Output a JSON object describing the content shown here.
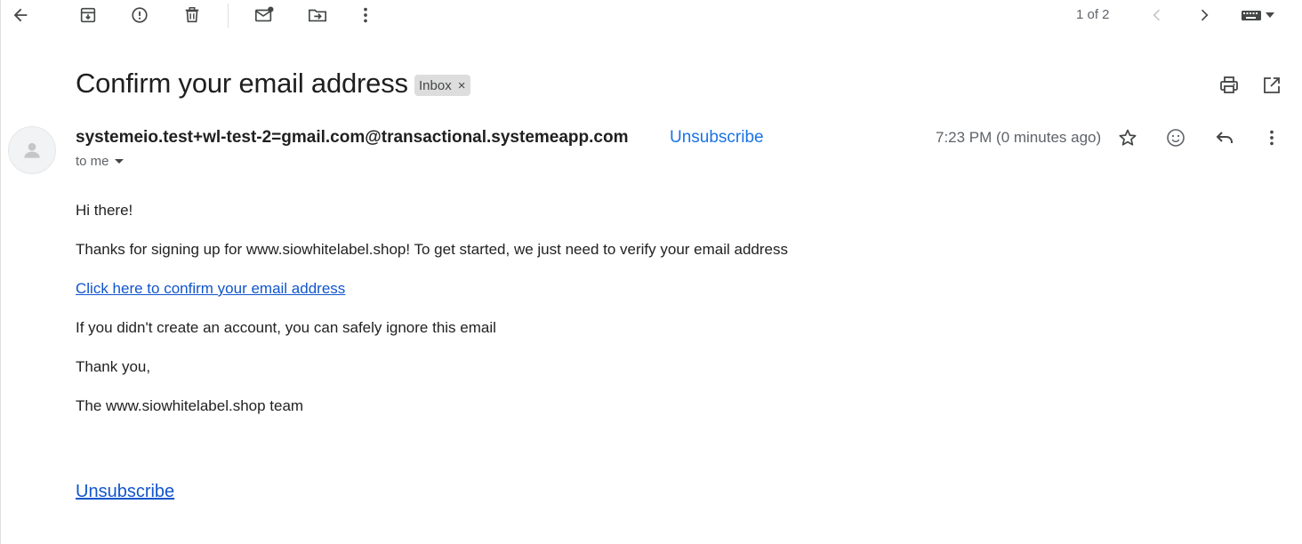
{
  "toolbar": {
    "back_icon": "arrow-back-icon",
    "archive_icon": "archive-icon",
    "report_spam_icon": "report-spam-icon",
    "delete_icon": "trash-icon",
    "mark_unread_icon": "mark-unread-icon",
    "move_to_icon": "move-to-icon",
    "more_icon": "more-vert-icon",
    "pager_text": "1 of 2",
    "prev_icon": "chevron-left-icon",
    "next_icon": "chevron-right-icon",
    "keyboard_icon": "keyboard-icon"
  },
  "email": {
    "subject": "Confirm your email address",
    "label": "Inbox",
    "label_remove": "×",
    "sender": "systemeio.test+wl-test-2=gmail.com@transactional.systemeapp.com",
    "unsubscribe_top": "Unsubscribe",
    "recipient": "to me",
    "time": "7:23 PM (0 minutes ago)",
    "body": {
      "greeting": "Hi there!",
      "paragraph1": "Thanks for signing up for www.siowhitelabel.shop! To get started, we just need to verify your email address",
      "confirm_link": "Click here to confirm your email address",
      "paragraph2": "If you didn't create an account, you can safely ignore this email",
      "closing": "Thank you,",
      "signature": "The www.siowhitelabel.shop team",
      "unsubscribe_bottom": "Unsubscribe"
    }
  },
  "colors": {
    "link": "#1155cc",
    "accent": "#1a73e8",
    "chip_bg": "#dddddd",
    "icon": "#444746",
    "muted": "#5f6368"
  }
}
